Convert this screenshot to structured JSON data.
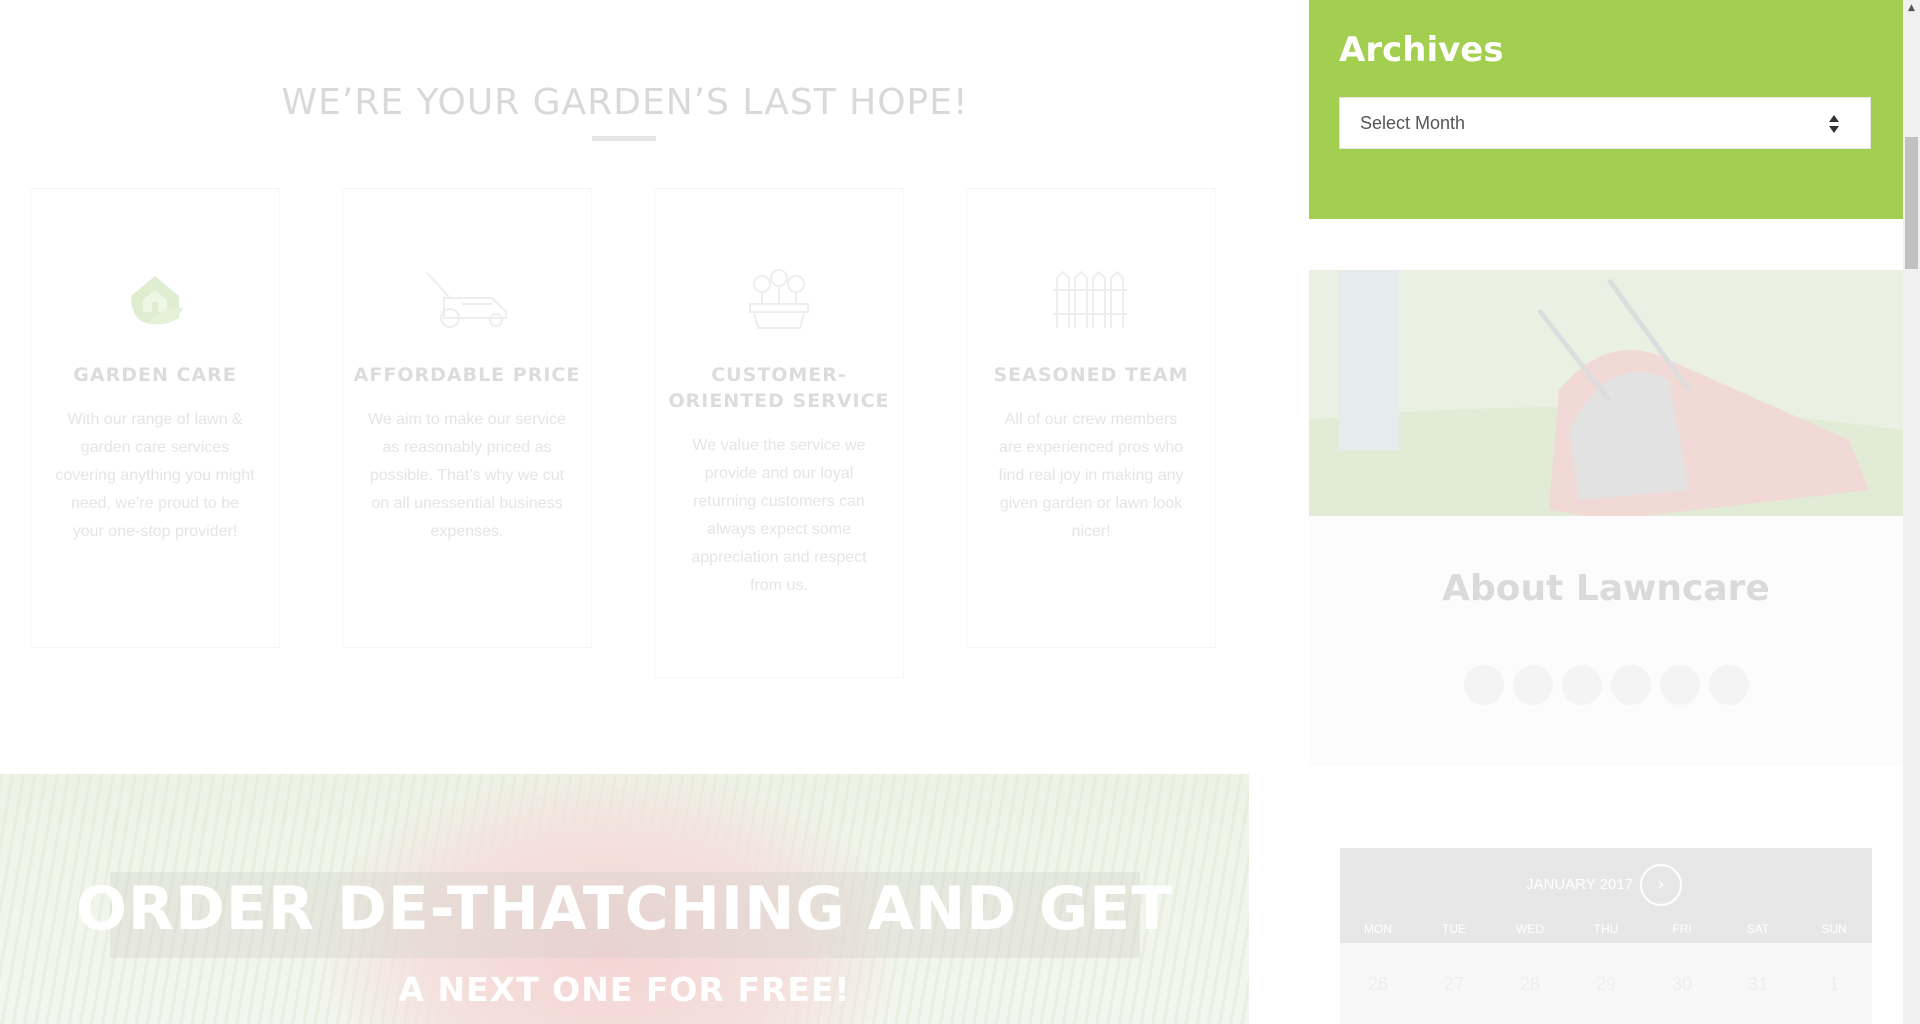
{
  "main": {
    "section_title": "WE’RE YOUR GARDEN’S LAST HOPE!",
    "features": [
      {
        "icon": "house-leaf-icon",
        "title": "GARDEN CARE",
        "text": "With our range of lawn & garden care services covering anything you might need, we’re proud to be your one-stop provider!"
      },
      {
        "icon": "lawn-mower-icon",
        "title": "AFFORDABLE PRICE",
        "text": "We aim to make our service as reasonably priced as possible. That’s why we cut on all unessential business expenses."
      },
      {
        "icon": "flower-box-icon",
        "title": "CUSTOMER-ORIENTED SERVICE",
        "text": "We value the service we provide and our loyal returning customers can always expect some appreciation and respect from us."
      },
      {
        "icon": "fence-icon",
        "title": "SEASONED TEAM",
        "text": "All of our crew members are experienced pros who find real joy in making any given garden or lawn look nicer!"
      }
    ],
    "promo": {
      "line1": "ORDER DE-THATCHING AND GET",
      "line2": "A NEXT ONE FOR FREE!"
    }
  },
  "sidebar": {
    "archives": {
      "title": "Archives",
      "select_value": "Select Month"
    },
    "about": {
      "title": "About Lawncare",
      "social_icons": [
        "facebook-icon",
        "twitter-icon",
        "google-plus-icon",
        "linkedin-icon",
        "pinterest-icon",
        "youtube-icon"
      ]
    },
    "calendar": {
      "month": "JANUARY 2017",
      "next_symbol": "›",
      "weekdays": [
        "MON",
        "TUE",
        "WED",
        "THU",
        "FRI",
        "SAT",
        "SUN"
      ],
      "first_row": [
        "26",
        "27",
        "28",
        "29",
        "30",
        "31",
        "1"
      ]
    }
  },
  "colors": {
    "accent_green": "#a2cf4f"
  }
}
